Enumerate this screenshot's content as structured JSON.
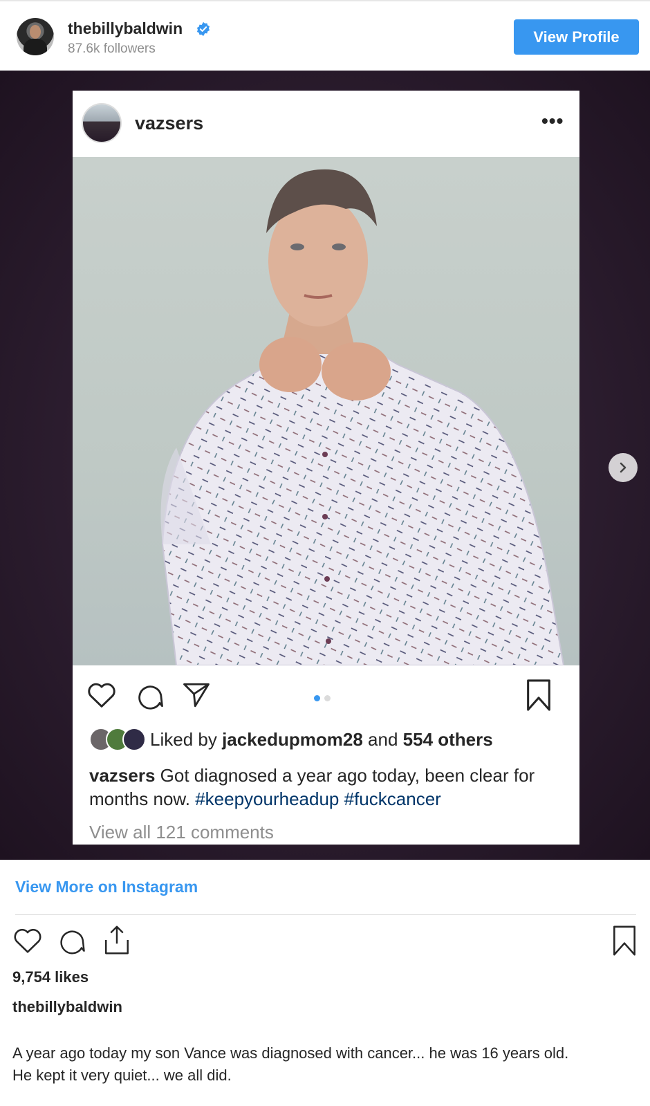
{
  "header": {
    "username": "thebillybaldwin",
    "followers": "87.6k followers",
    "view_profile_label": "View Profile"
  },
  "embed": {
    "username": "vazsers",
    "more_label": "•••",
    "likes": {
      "liked_by_prefix": "Liked by ",
      "liked_by_user": "jackedupmom28",
      "and_text": " and ",
      "others": "554 others"
    },
    "caption": {
      "username": "vazsers",
      "text": " Got diagnosed a year ago today, been clear for months now. ",
      "hashtag1": "#keepyourheadup",
      "hashtag2": "#fuckcancer"
    },
    "view_comments": "View all 121 comments",
    "carousel_dots": 2,
    "active_dot": 0
  },
  "colors": {
    "accent": "#3897f0",
    "hashtag": "#003569",
    "muted": "#8e8e8e",
    "media_bg": "#2c1d2f"
  },
  "footer": {
    "view_more_label": "View More on Instagram",
    "likes_count": "9,754 likes",
    "owner": "thebillybaldwin",
    "post_lines": [
      "A year ago today my son Vance was diagnosed with cancer... he was 16 years old.",
      "He kept it very quiet... we all did."
    ]
  }
}
